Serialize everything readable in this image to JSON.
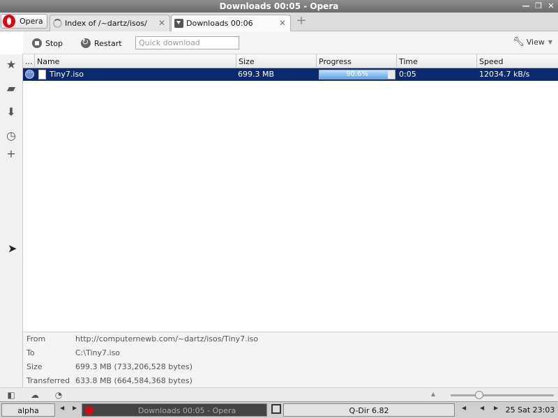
{
  "window": {
    "title": "Downloads 00:05 - Opera"
  },
  "tabs": {
    "opera_menu": "Opera",
    "items": [
      {
        "label": "Index of /~dartz/isos/"
      },
      {
        "label": "Downloads 00:06"
      }
    ]
  },
  "toolbar": {
    "stop_label": "Stop",
    "restart_label": "Restart",
    "quick_download_placeholder": "Quick download",
    "view_label": "View"
  },
  "table": {
    "columns": [
      "...",
      "Name",
      "Size",
      "Progress",
      "Time",
      "Speed"
    ],
    "rows": [
      {
        "name": "Tiny7.iso",
        "size": "699.3 MB",
        "progress": "90.6%",
        "progress_value": 0.906,
        "time": "0:05",
        "speed": "12034.7 kB/s"
      }
    ]
  },
  "details": {
    "from_label": "From",
    "from_value": "http://computernewb.com/~dartz/isos/Tiny7.iso",
    "to_label": "To",
    "to_value": "C:\\Tiny7.iso",
    "size_label": "Size",
    "size_value": "699.3 MB (733,206,528 bytes)",
    "transferred_label": "Transferred",
    "transferred_value": "633.8 MB (664,584,368 bytes)"
  },
  "taskbar": {
    "workspace": "alpha",
    "task": "Downloads 00:05 - Opera",
    "app": "Q-Dir 6.82",
    "clock": "25 Sat 23:03"
  },
  "colors": {
    "selection": "#0b2a6e",
    "opera_red": "#d70a12",
    "progress": "#5aa6e9"
  }
}
